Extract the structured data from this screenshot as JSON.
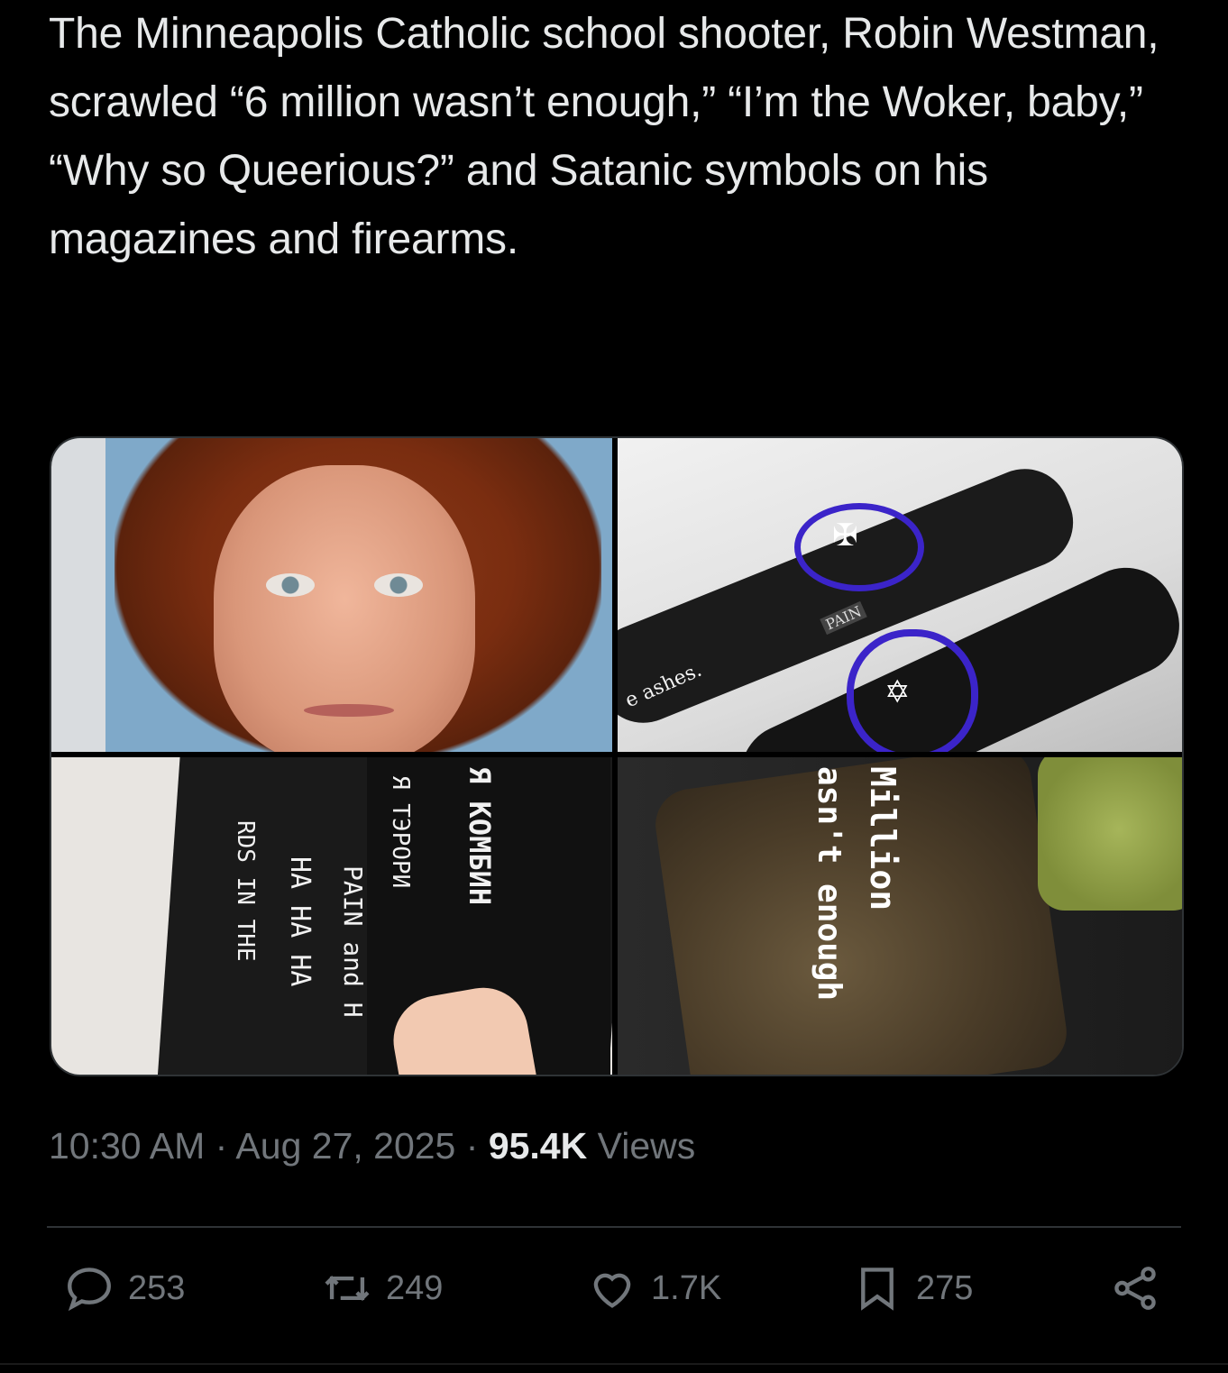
{
  "tweet": {
    "text": "The Minneapolis Catholic school shooter, Robin Westman, scrawled “6 million wasn’t enough,” “I’m the Woker, baby,” “Why so Queerious?” and Satanic symbols on his magazines and firearms."
  },
  "media": {
    "tile2": {
      "scrawl_left": "e ashes.",
      "scrawl_label": "PAIN"
    },
    "tile3": {
      "line1": "RDS IN THE",
      "line2": "HA HA HA",
      "line3": "PAIN and H",
      "line4": "Я ТЭРОРИ",
      "line5": "Я КОМБИН"
    },
    "tile4": {
      "line1": "Million",
      "line2": "asn't enough"
    }
  },
  "meta": {
    "time": "10:30 AM",
    "sep1": " · ",
    "date": "Aug 27, 2025",
    "sep2": " · ",
    "views_count": "95.4K",
    "views_label": " Views"
  },
  "actions": {
    "reply_count": "253",
    "retweet_count": "249",
    "like_count": "1.7K",
    "bookmark_count": "275"
  },
  "icons": {
    "reply": "reply-icon",
    "retweet": "retweet-icon",
    "like": "heart-icon",
    "bookmark": "bookmark-icon",
    "share": "share-icon"
  },
  "colors": {
    "background": "#000000",
    "text": "#e7e9ea",
    "secondary": "#71767b",
    "divider": "#2f3336",
    "circle_annotation": "#3b24c9"
  }
}
